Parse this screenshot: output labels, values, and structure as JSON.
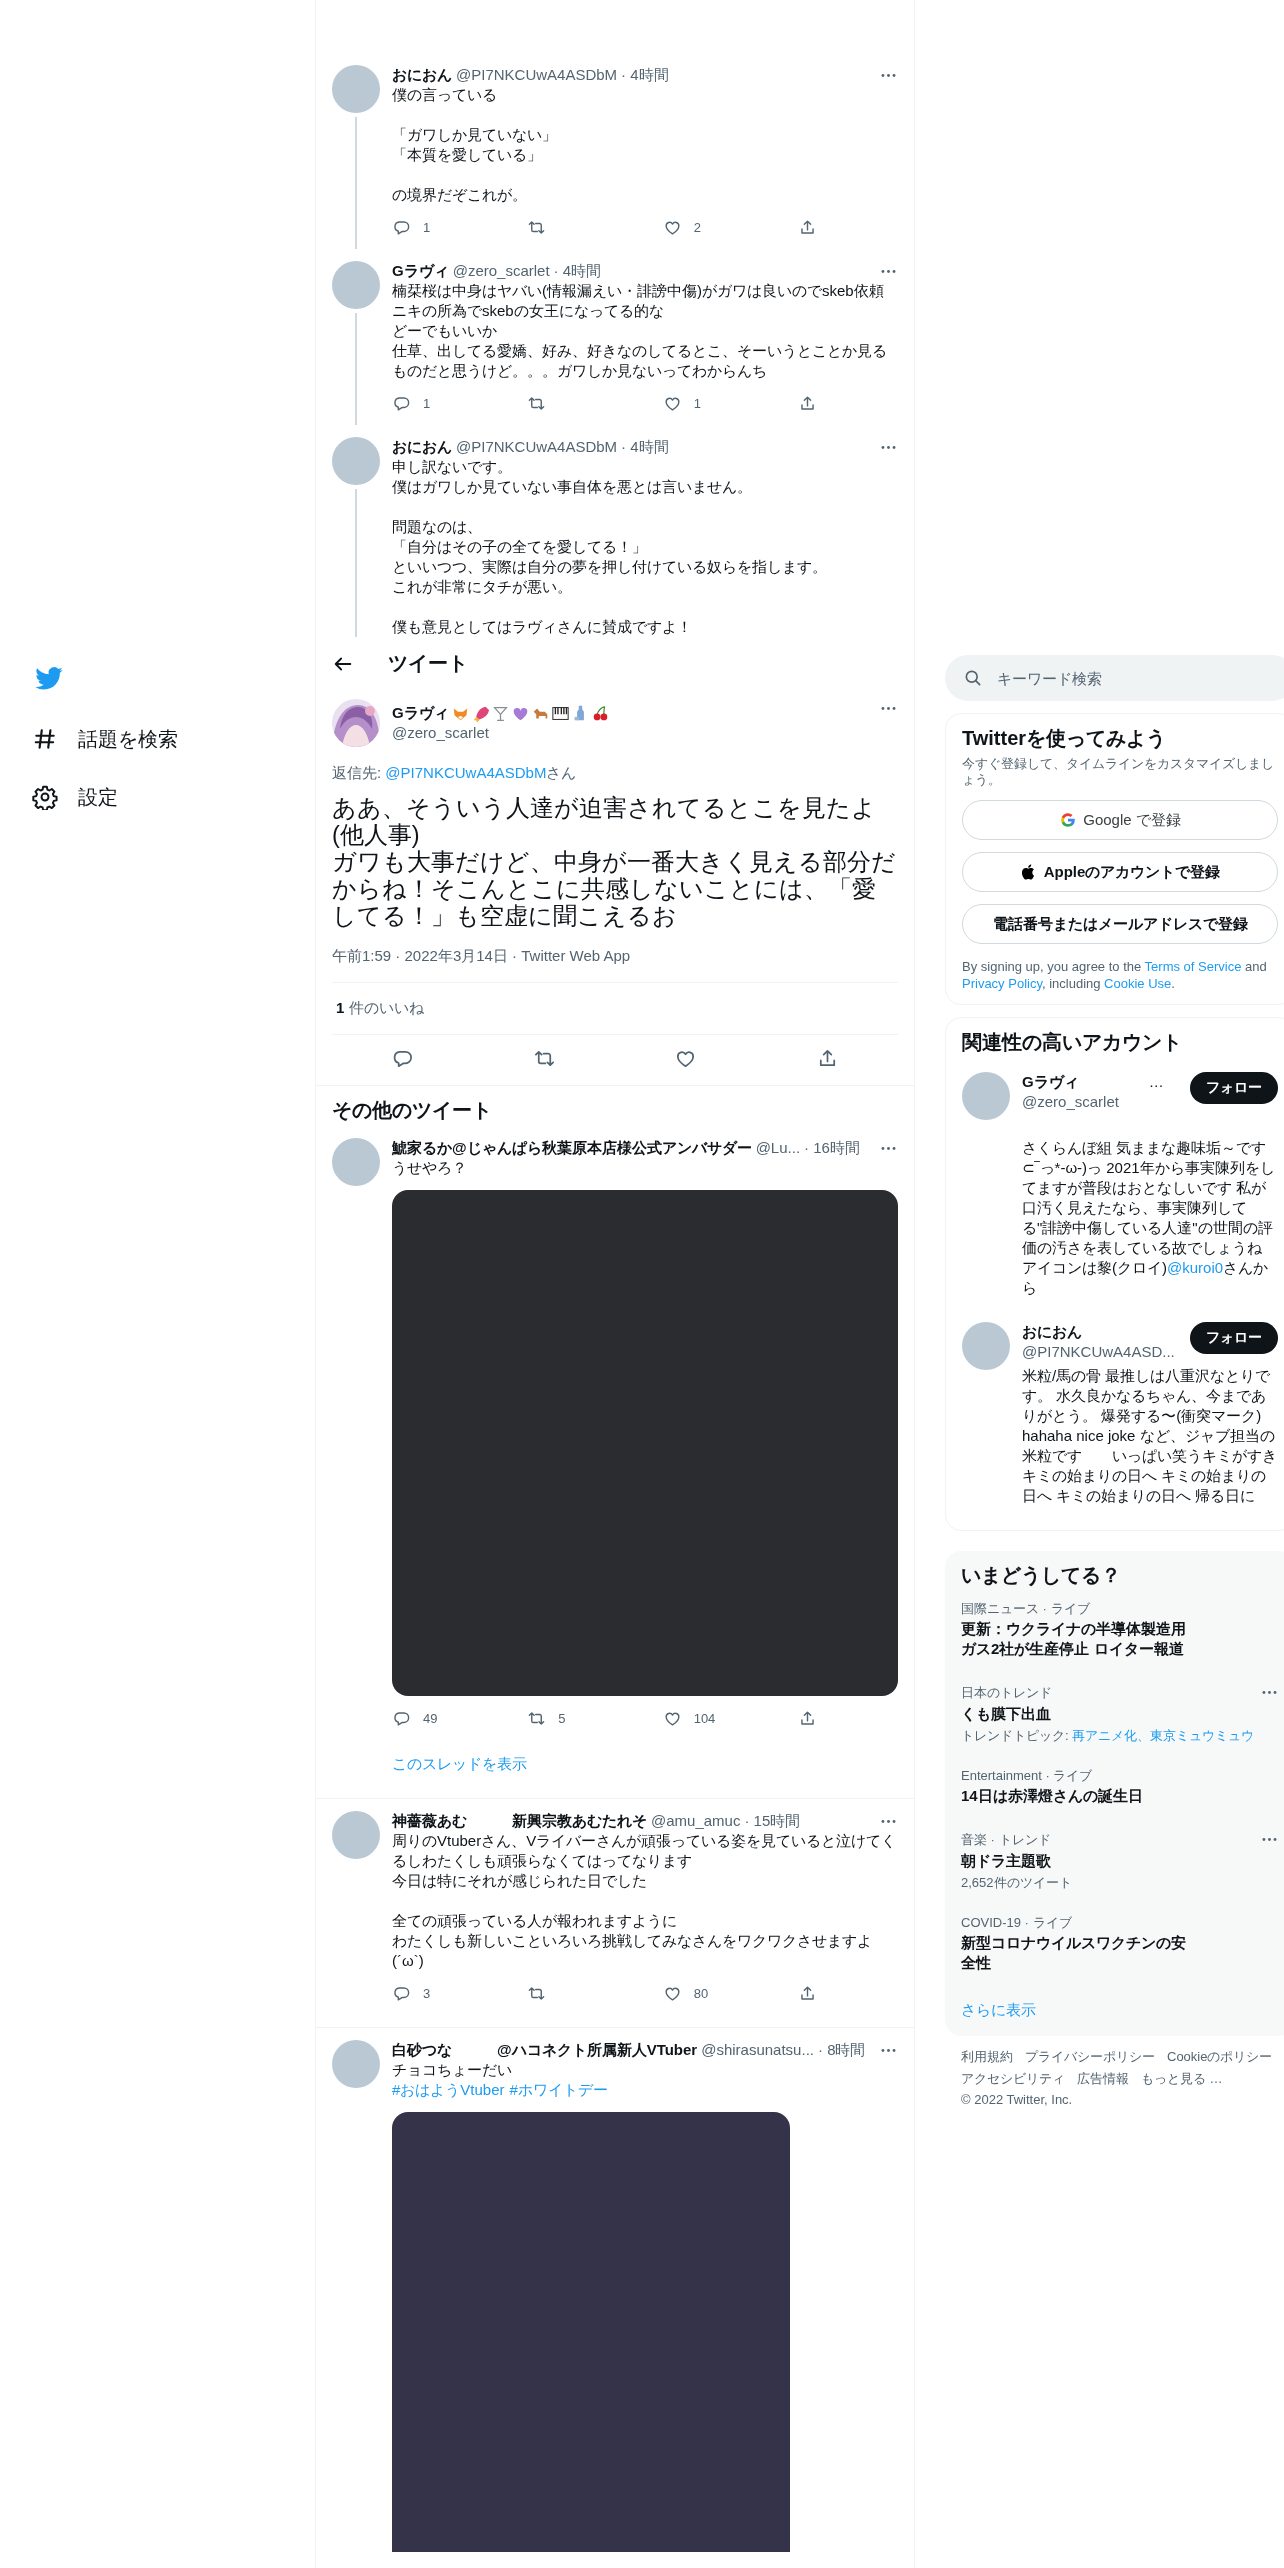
{
  "nav": {
    "items": [
      {
        "kind": "explore",
        "label": "話題を検索"
      },
      {
        "kind": "settings",
        "label": "設定"
      }
    ]
  },
  "thread": [
    {
      "name": "おにおん",
      "handle": "@PI7NKCUwA4ASDbM",
      "time": "· 4時間",
      "paragraphs": [
        [
          "僕の言っている"
        ],
        [
          "「ガワしか見ていない」",
          "「本質を愛している」"
        ],
        [
          "の境界だぞこれが。"
        ]
      ],
      "stats": {
        "reply": "1",
        "like": "2"
      }
    },
    {
      "name": "Gラヴィ",
      "handle": "@zero_scarlet",
      "time": "· 4時間",
      "paragraphs": [
        [
          "楠栞桜は中身はヤバい(情報漏えい・誹謗中傷)がガワは良いのでskeb依頼ニキの所為でskebの女王になってる的な",
          "どーでもいいか",
          "仕草、出してる愛嬌、好み、好きなのしてるとこ、そーいうとことか見るものだと思うけど。。。ガワしか見ないってわからんち"
        ]
      ],
      "stats": {
        "reply": "1",
        "like": "1"
      }
    },
    {
      "name": "おにおん",
      "handle": "@PI7NKCUwA4ASDbM",
      "time": "· 4時間",
      "paragraphs": [
        [
          "申し訳ないです。",
          "僕はガワしか見ていない事自体を悪とは言いません。"
        ],
        [
          "問題なのは、",
          "「自分はその子の全てを愛してる！」",
          "といいつつ、実際は自分の夢を押し付けている奴らを指します。",
          "これが非常にタチが悪い。"
        ],
        [
          "僕も意見としてはラヴィさんに賛成ですよ！"
        ]
      ]
    }
  ],
  "header": {
    "title": "ツイート"
  },
  "main_tweet": {
    "name": "Gラヴィ",
    "handle": "@zero_scarlet",
    "reply_to": {
      "prefix": "返信先: ",
      "handle": "@PI7NKCUwA4ASDbM",
      "suffix": "さん"
    },
    "lines": [
      "ああ、そういう人達が迫害されてるとこを見たよ(他人事)",
      "ガワも大事だけど、中身が一番大きく見える部分だからね！そこんとこに共感しないことには、「愛してる！」も空虚に聞こえるお"
    ],
    "meta": "午前1:59 · 2022年3月14日 · Twitter Web App",
    "likes": "**1** 件のいいね"
  },
  "more_tweets": {
    "title": "その他のツイート",
    "tweets": [
      {
        "name": "鯱家るか@じゃんぱら秋葉原本店様公式アンバサダー",
        "handle": "@Lu...",
        "time": "· 16時間",
        "paragraphs": [
          [
            "うせやろ？"
          ]
        ],
        "media": {
          "color": "#2b2c2f"
        },
        "stats": {
          "reply": "49",
          "retweet": "5",
          "like": "104"
        },
        "show_thread": "このスレッドを表示"
      },
      {
        "name": "神薔薇あむ　　　新興宗教あむたれそ",
        "handle": "@amu_amuc",
        "time": "· 15時間",
        "paragraphs": [
          [
            "周りのVtuberさん、Vライバーさんが頑張っている姿を見ていると泣けてくるしわたくしも頑張らなくてはってなります",
            "今日は特にそれが感じられた日でした"
          ],
          [
            "全ての頑張っている人が報われますように",
            "わたくしも新しいこといろいろ挑戦してみなさんをワクワクさせますよ(´ω`)"
          ]
        ],
        "stats": {
          "reply": "3",
          "like": "80"
        }
      },
      {
        "name": "白砂つな　　　@ハコネクト所属新人VTuber",
        "handle": "@shirasunatsu...",
        "time": "· 8時間",
        "paragraphs": [
          [
            "チョコちょーだい"
          ]
        ],
        "tags": [
          "#おはようVtuber",
          "#ホワイトデー"
        ],
        "media": {
          "color": "#34334a"
        }
      }
    ]
  },
  "search": {
    "placeholder": "キーワード検索"
  },
  "signup": {
    "title": "Twitterを使ってみよう",
    "text": "今すぐ登録して、タイムラインをカスタマイズしましょう。",
    "buttons": [
      {
        "kind": "google",
        "label": "Google で登録"
      },
      {
        "kind": "apple",
        "label": "Appleのアカウントで登録"
      },
      {
        "kind": "phone",
        "label": "電話番号またはメールアドレスで登録"
      }
    ],
    "legal": {
      "texts": [
        "By signing up, you agree to the ",
        " and ",
        ", including ",
        "."
      ],
      "links": [
        "Terms of Service",
        "Privacy Policy",
        "Cookie Use"
      ]
    }
  },
  "accounts": {
    "title": "関連性の高いアカウント",
    "items": [
      {
        "name": "Gラヴィ",
        "trail": "…",
        "handle": "@zero_scarlet",
        "follow": "フォロー",
        "bio": [
          {
            "texts": [
              "さくらんぼ組 気ままな趣味垢～です ⊂‾っ*-ω-)っ 2021年から事実陳列をしてますが普段はおとなしいです 私が口汚く見えたなら、事実陳列してる\"誹謗中傷している人達\"の世間の評価の汚さを表している故でしょうね"
            ]
          },
          {
            "texts": [
              "アイコンは黎(クロイ)",
              "さんから"
            ],
            "links": [
              "@kuroi0"
            ]
          }
        ]
      },
      {
        "name": "おにおん",
        "handle": "@PI7NKCUwA4ASD...",
        "follow": "フォロー",
        "bio": [
          {
            "texts": [
              "米粒/馬の骨 最推しは八重沢なとりです。 水久良かなるちゃん、今までありがとう。 爆発する〜(衝突マーク) hahaha nice joke など、ジャブ担当の米粒です　　いっぱい笑うキミがすきキミの始まりの日へ キミの始まりの日へ キミの始まりの日へ 帰る日に"
            ]
          }
        ]
      }
    ]
  },
  "trends": {
    "title": "いまどうしてる？",
    "items": [
      {
        "category": "国際ニュース · ライブ",
        "title": "更新：ウクライナの半導体製造用ガス2社が生産停止 ロイター報道",
        "more": false
      },
      {
        "category": "日本のトレンド",
        "title": "くも膜下出血",
        "topics": {
          "label": "トレンドトピック: ",
          "links": "再アニメ化、東京ミュウミュウ"
        },
        "more": true
      },
      {
        "category": "Entertainment · ライブ",
        "title": "14日は赤澤燈さんの誕生日",
        "more": false
      },
      {
        "category": "音楽 · トレンド",
        "title": "朝ドラ主題歌",
        "count": "2,652件のツイート",
        "more": true
      },
      {
        "category": "COVID-19 · ライブ",
        "title": "新型コロナウイルスワクチンの安全性",
        "more": false
      }
    ],
    "show_more": "さらに表示"
  },
  "footer": [
    "利用規約",
    "プライバシーポリシー",
    "Cookieのポリシー",
    "アクセシビリティ",
    "広告情報",
    "もっと見る …",
    "© 2022 Twitter, Inc."
  ]
}
